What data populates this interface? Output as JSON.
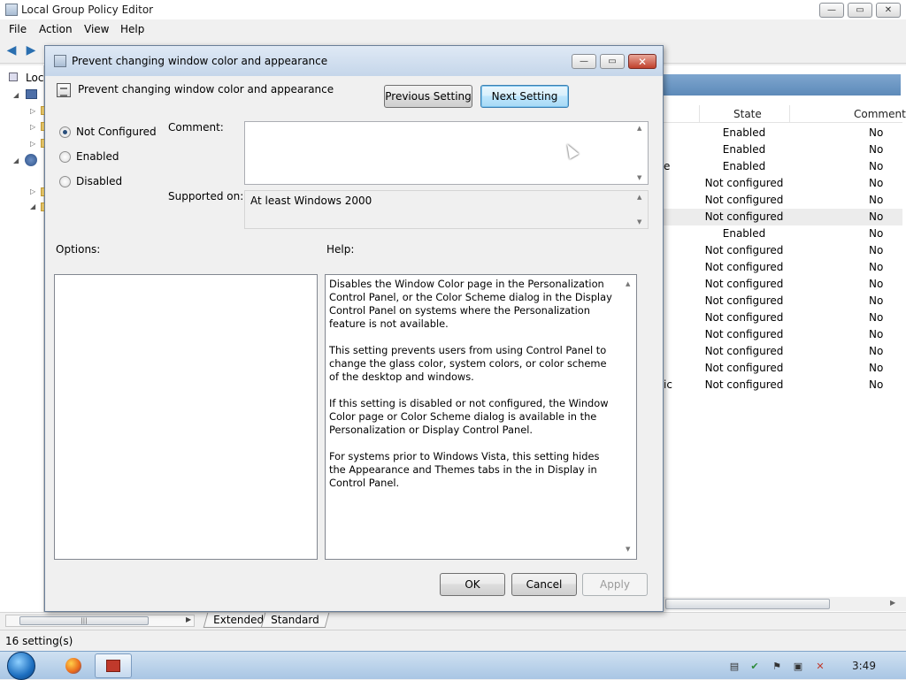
{
  "window": {
    "title": "Local Group Policy Editor",
    "caption_buttons": {
      "minimize": "—",
      "restore": "▭",
      "close": "✕"
    }
  },
  "menu": [
    {
      "label": "File",
      "accel": "F"
    },
    {
      "label": "Action",
      "accel": "A"
    },
    {
      "label": "View",
      "accel": "V"
    },
    {
      "label": "Help",
      "accel": "H"
    }
  ],
  "menu_labels": {
    "file": "File",
    "action": "Action",
    "view": "View",
    "help": "Help"
  },
  "toolbar": {
    "back_icon": "back-arrow-icon",
    "forward_icon": "forward-arrow-icon"
  },
  "tree": {
    "root_label": "Loc"
  },
  "list": {
    "columns": {
      "state": "State",
      "comment": "Comment"
    },
    "rows": [
      {
        "state": "Enabled",
        "comment": "No"
      },
      {
        "state": "Enabled",
        "comment": "No"
      },
      {
        "state": "Enabled",
        "comment": "No"
      },
      {
        "state": "Not configured",
        "comment": "No"
      },
      {
        "state": "Not configured",
        "comment": "No"
      },
      {
        "state": "Not configured",
        "comment": "No"
      },
      {
        "state": "Enabled",
        "comment": "No"
      },
      {
        "state": "Not configured",
        "comment": "No"
      },
      {
        "state": "Not configured",
        "comment": "No"
      },
      {
        "state": "Not configured",
        "comment": "No"
      },
      {
        "state": "Not configured",
        "comment": "No"
      },
      {
        "state": "Not configured",
        "comment": "No"
      },
      {
        "state": "Not configured",
        "comment": "No"
      },
      {
        "state": "Not configured",
        "comment": "No"
      },
      {
        "state": "Not configured",
        "comment": "No"
      },
      {
        "state": "Not configured",
        "comment": "No"
      }
    ],
    "cut_text": {
      "row3": "e",
      "row16": "ic"
    }
  },
  "view_tabs": {
    "extended": "Extended",
    "standard": "Standard"
  },
  "status": {
    "text": "16 setting(s)"
  },
  "dialog": {
    "title": "Prevent changing window color and appearance",
    "setting_name": "Prevent changing window color and appearance",
    "prev_button": "Previous Setting",
    "next_button": "Next Setting",
    "radios": {
      "not_configured": "Not Configured",
      "enabled": "Enabled",
      "disabled": "Disabled",
      "selected": "Not Configured"
    },
    "comment_label": "Comment:",
    "comment_value": "",
    "supported_label": "Supported on:",
    "supported_value": "At least Windows 2000",
    "options_label": "Options:",
    "help_label": "Help:",
    "help_paragraphs": [
      "Disables the Window Color page in the Personalization Control Panel, or the Color Scheme dialog in the Display Control Panel on systems where the Personalization feature is not available.",
      "This setting prevents users from using Control Panel to change the glass color, system colors, or color scheme of the desktop and windows.",
      "If this setting is disabled or not configured, the Window Color page or Color Scheme dialog is available in the Personalization or Display Control Panel.",
      "For systems prior to Windows Vista, this setting hides the Appearance and Themes tabs in the in Display in Control Panel."
    ],
    "ok_button": "OK",
    "cancel_button": "Cancel",
    "apply_button": "Apply"
  },
  "taskbar": {
    "clock": "3:49"
  },
  "colors": {
    "list_header_band": "#5d8ab9",
    "focus_button": "#bee6fd",
    "close_button": "#c0402c",
    "radio_dot": "#2a4f7c"
  }
}
